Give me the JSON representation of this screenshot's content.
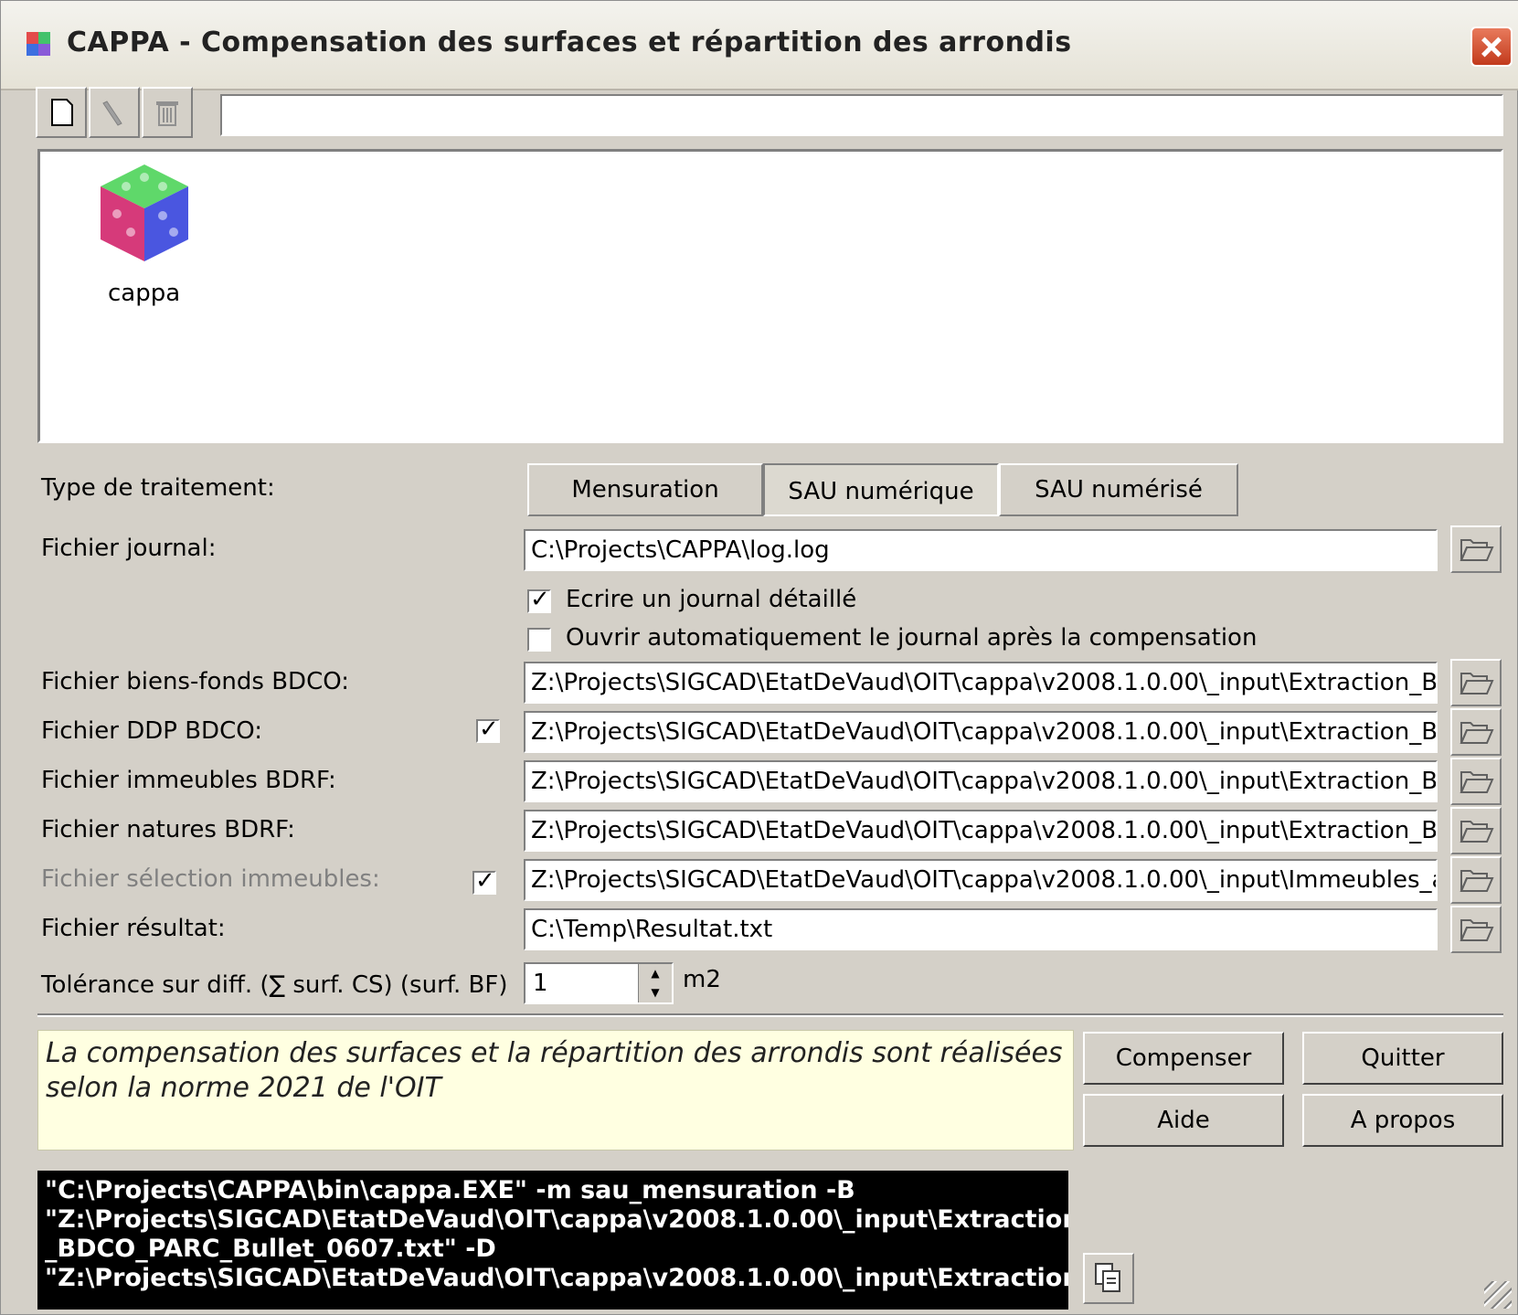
{
  "window": {
    "title": "CAPPA - Compensation des surfaces et répartition des arrondis"
  },
  "toolbar": {
    "new_icon": "new-document-icon",
    "edit_icon": "pencil-icon",
    "delete_icon": "trash-icon",
    "path_value": ""
  },
  "list": {
    "items": [
      {
        "label": "cappa",
        "icon": "cube-icon"
      }
    ]
  },
  "form": {
    "type_label": "Type de traitement:",
    "type_options": [
      "Mensuration",
      "SAU numérique",
      "SAU numérisé"
    ],
    "type_selected": "SAU numérique",
    "journal_label": "Fichier journal:",
    "journal_value": "C:\\Projects\\CAPPA\\log.log",
    "detailed_label": "Ecrire un journal détaillé",
    "open_label": "Ouvrir automatiquement le journal après la compensation",
    "bf_label": "Fichier biens-fonds BDCO:",
    "bf_value": "Z:\\Projects\\SIGCAD\\EtatDeVaud\\OIT\\cappa\\v2008.1.0.00\\_input\\Extraction_BD",
    "ddp_label": "Fichier DDP BDCO:",
    "ddp_value": "Z:\\Projects\\SIGCAD\\EtatDeVaud\\OIT\\cappa\\v2008.1.0.00\\_input\\Extraction_BD",
    "imm_label": "Fichier immeubles BDRF:",
    "imm_value": "Z:\\Projects\\SIGCAD\\EtatDeVaud\\OIT\\cappa\\v2008.1.0.00\\_input\\Extraction_BD",
    "nat_label": "Fichier natures BDRF:",
    "nat_value": "Z:\\Projects\\SIGCAD\\EtatDeVaud\\OIT\\cappa\\v2008.1.0.00\\_input\\Extraction_BD",
    "sel_label": "Fichier sélection immeubles:",
    "sel_value": "Z:\\Projects\\SIGCAD\\EtatDeVaud\\OIT\\cappa\\v2008.1.0.00\\_input\\Immeubles_a_t",
    "res_label": "Fichier résultat:",
    "res_value": "C:\\Temp\\Resultat.txt",
    "tol_label": "Tolérance sur diff. (∑ surf. CS) (surf. BF)",
    "tol_value": "1",
    "tol_unit": "m2"
  },
  "info": {
    "text": "La compensation des surfaces et la répartition des arrondis sont réalisées selon la norme 2021 de l'OIT"
  },
  "buttons": {
    "compenser": "Compenser",
    "quitter": "Quitter",
    "aide": "Aide",
    "apropos": "A propos"
  },
  "console": {
    "text": "\"C:\\Projects\\CAPPA\\bin\\cappa.EXE\" -m sau_mensuration -B\n\"Z:\\Projects\\SIGCAD\\EtatDeVaud\\OIT\\cappa\\v2008.1.0.00\\_input\\Extraction\n_BDCO_PARC_Bullet_0607.txt\" -D\n\"Z:\\Projects\\SIGCAD\\EtatDeVaud\\OIT\\cappa\\v2008.1.0.00\\_input\\Extraction"
  }
}
